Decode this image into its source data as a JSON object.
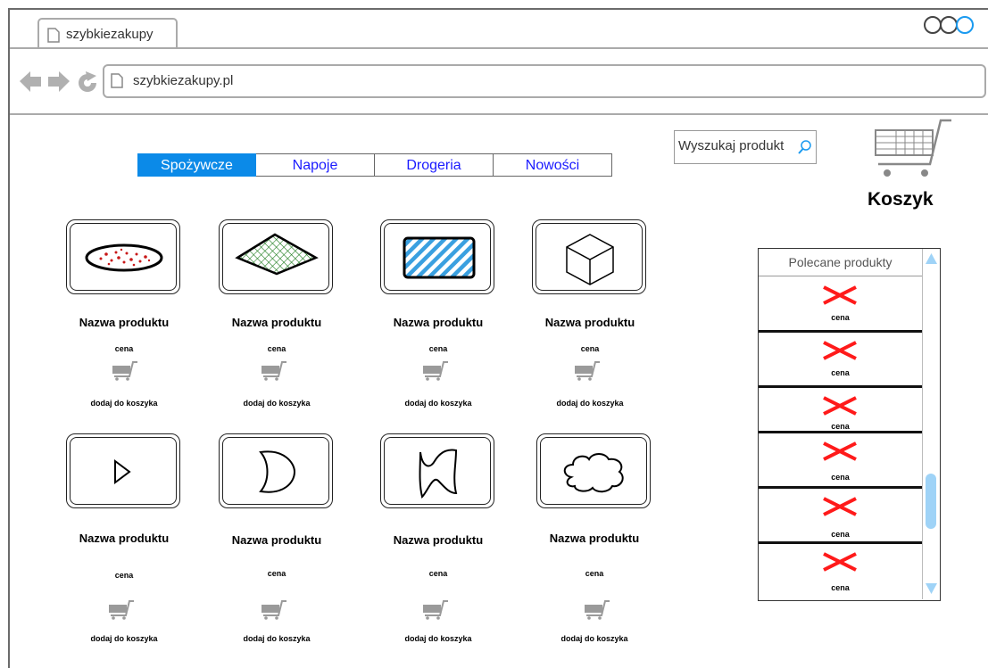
{
  "browser": {
    "tab_title": "szybkiezakupy",
    "url": "szybkiezakupy.pl"
  },
  "menu": {
    "items": [
      "Spożywcze",
      "Napoje",
      "Drogeria",
      "Nowości"
    ],
    "active_index": 0
  },
  "search": {
    "placeholder": "Wyszukaj produkt"
  },
  "cart": {
    "label": "Koszyk"
  },
  "products": [
    {
      "name": "Nazwa produktu",
      "price": "cena",
      "add": "dodaj do koszyka",
      "icon": "ellipse-dots-icon"
    },
    {
      "name": "Nazwa produktu",
      "price": "cena",
      "add": "dodaj do koszyka",
      "icon": "diamond-grid-icon"
    },
    {
      "name": "Nazwa produktu",
      "price": "cena",
      "add": "dodaj do koszyka",
      "icon": "hatched-rectangle-icon"
    },
    {
      "name": "Nazwa produktu",
      "price": "cena",
      "add": "dodaj do koszyka",
      "icon": "cube-icon"
    },
    {
      "name": "Nazwa produktu",
      "price": "cena",
      "add": "dodaj do koszyka",
      "icon": "triangle-icon"
    },
    {
      "name": "Nazwa produktu",
      "price": "cena",
      "add": "dodaj do koszyka",
      "icon": "moon-icon"
    },
    {
      "name": "Nazwa produktu",
      "price": "cena",
      "add": "dodaj do koszyka",
      "icon": "wave-icon"
    },
    {
      "name": "Nazwa produktu",
      "price": "cena",
      "add": "dodaj do koszyka",
      "icon": "cloud-icon"
    }
  ],
  "recommended": {
    "title": "Polecane produkty",
    "items": [
      {
        "price": "cena"
      },
      {
        "price": "cena"
      },
      {
        "price": "cena"
      },
      {
        "price": "cena"
      },
      {
        "price": "cena"
      },
      {
        "price": "cena"
      }
    ]
  },
  "colors": {
    "accent": "#0b8ae8",
    "link": "#1a1aff",
    "remove": "#ff1a1a",
    "scrollbar": "#9fd3f7"
  }
}
